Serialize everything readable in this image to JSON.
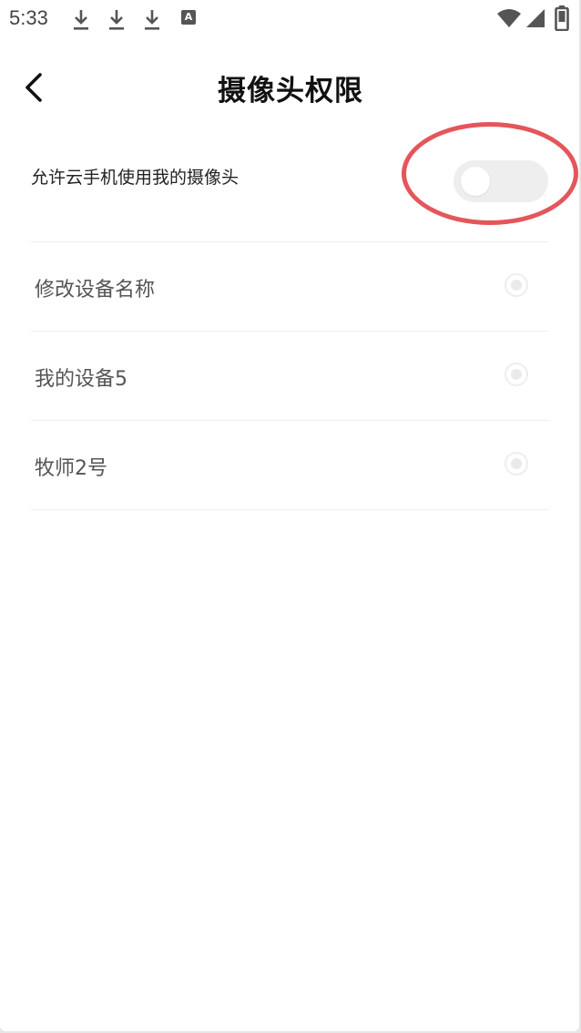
{
  "status_bar": {
    "time": "5:33",
    "a_badge": "A",
    "icons": [
      "download-icon",
      "download-icon",
      "download-icon",
      "a-badge-icon",
      "wifi-icon",
      "signal-icon",
      "battery-icon"
    ]
  },
  "header": {
    "title": "摄像头权限",
    "back_icon": "chevron-left-icon"
  },
  "camera_permission": {
    "label": "允许云手机使用我的摄像头",
    "enabled": false,
    "highlight_color": "#e4565b"
  },
  "devices": [
    {
      "name": "修改设备名称",
      "selected": false
    },
    {
      "name": "我的设备5",
      "selected": false
    },
    {
      "name": "牧师2号",
      "selected": false
    }
  ],
  "colors": {
    "background": "#ffffff",
    "divider": "#eeeeee",
    "toggle_off": "#eeeeee",
    "text_secondary": "#555555"
  }
}
